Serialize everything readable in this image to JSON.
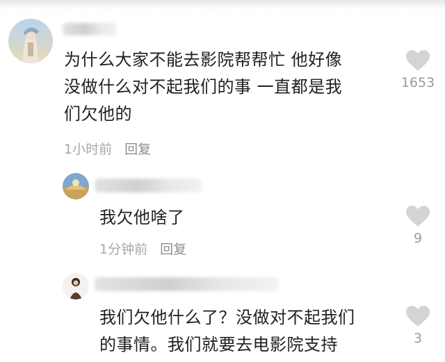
{
  "comments": [
    {
      "text": "为什么大家不能去影院帮帮忙 他好像\n没做什么对不起我们的事 一直都是我\n们欠他的",
      "time": "1小时前",
      "reply_label": "回复",
      "likes": "1653"
    },
    {
      "text": "我欠他啥了",
      "time": "1分钟前",
      "reply_label": "回复",
      "likes": "9"
    },
    {
      "text": "我们欠他什么了？没做对不起我们\n的事情。我们就要去电影院支持",
      "likes": "3"
    }
  ],
  "colors": {
    "text": "#1f1f1f",
    "meta": "#a7a7a7",
    "heart": "#d4d4d4"
  },
  "icons": [
    "heart-icon",
    "avatar"
  ]
}
